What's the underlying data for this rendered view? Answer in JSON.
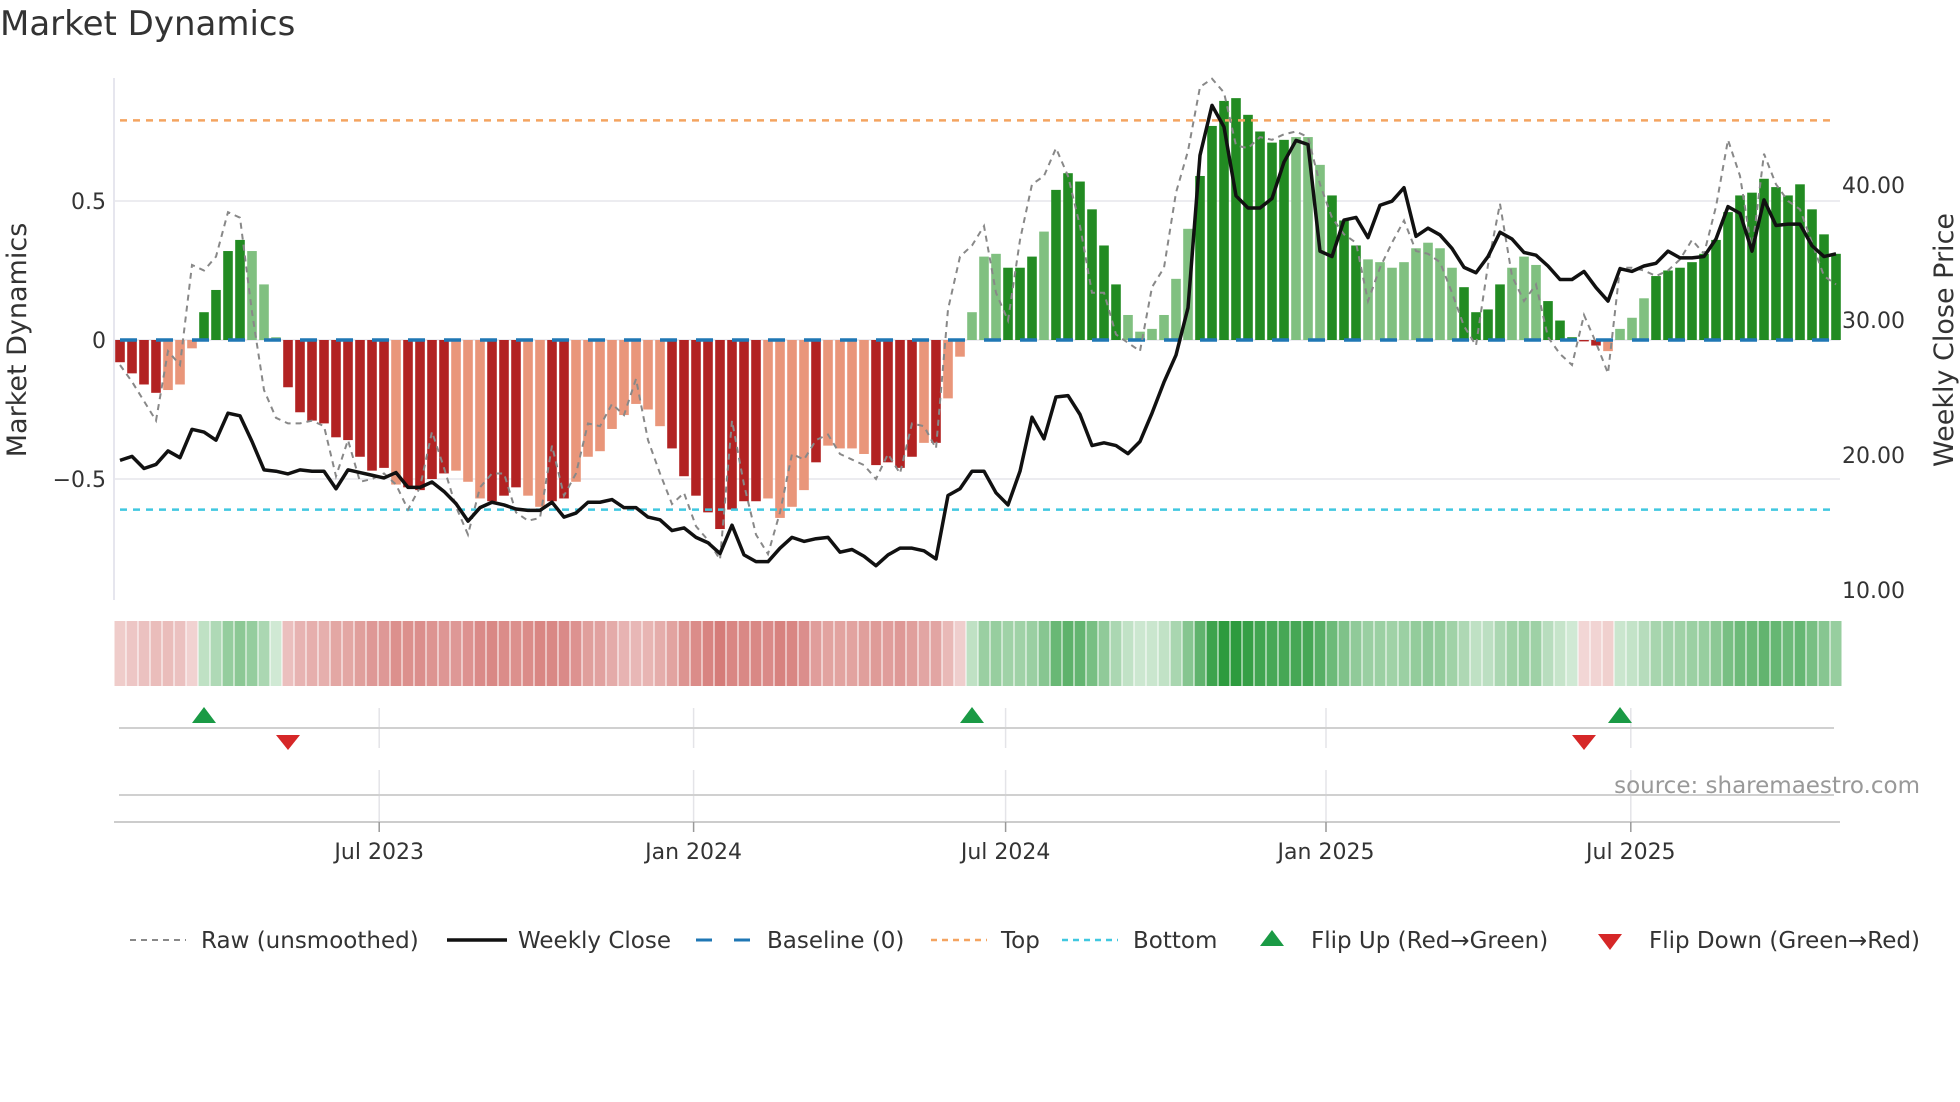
{
  "title": "Market Dynamics",
  "source": "source: sharemaestro.com",
  "colors": {
    "bar_dark_pos": "#228b22",
    "bar_light_pos": "#80c080",
    "bar_dark_neg": "#b22222",
    "bar_light_neg": "#e9967a",
    "close": "#111111",
    "raw": "#888888",
    "baseline": "#1f77b4",
    "top": "#f4a460",
    "bottom": "#40c8e0",
    "flip_up": "#1a9a45",
    "flip_down": "#d62728"
  },
  "chart_data": {
    "type": "bar",
    "title": "Market Dynamics",
    "ylabel": "Market Dynamics",
    "y2label": "Weekly Close Price",
    "ylim": [
      -0.94,
      0.94
    ],
    "y2lim": [
      9.2,
      47.9
    ],
    "yticks": [
      {
        "v": 0.5,
        "label": "0.5"
      },
      {
        "v": 0,
        "label": "0"
      },
      {
        "v": -0.5,
        "label": "−0.5"
      }
    ],
    "y2ticks": [
      {
        "v": 40,
        "label": "40.00"
      },
      {
        "v": 30,
        "label": "30.00"
      },
      {
        "v": 20,
        "label": "20.00"
      },
      {
        "v": 10,
        "label": "10.00"
      }
    ],
    "xticks": [
      {
        "week": 21.6,
        "label": "Jul 2023"
      },
      {
        "week": 47.8,
        "label": "Jan 2024"
      },
      {
        "week": 73.8,
        "label": "Jul 2024"
      },
      {
        "week": 100.5,
        "label": "Jan 2025"
      },
      {
        "week": 125.9,
        "label": "Jul 2025"
      }
    ],
    "top_level": 0.79,
    "bottom_level": -0.61,
    "baseline": 0,
    "momentum": [
      -0.08,
      -0.12,
      -0.16,
      -0.19,
      -0.18,
      -0.16,
      -0.03,
      0.1,
      0.18,
      0.32,
      0.36,
      0.32,
      0.2,
      0.01,
      -0.17,
      -0.26,
      -0.29,
      -0.3,
      -0.35,
      -0.36,
      -0.42,
      -0.47,
      -0.46,
      -0.52,
      -0.53,
      -0.54,
      -0.5,
      -0.48,
      -0.47,
      -0.51,
      -0.57,
      -0.58,
      -0.56,
      -0.53,
      -0.56,
      -0.6,
      -0.58,
      -0.57,
      -0.51,
      -0.42,
      -0.4,
      -0.32,
      -0.27,
      -0.23,
      -0.25,
      -0.31,
      -0.39,
      -0.49,
      -0.56,
      -0.62,
      -0.68,
      -0.61,
      -0.58,
      -0.58,
      -0.57,
      -0.64,
      -0.6,
      -0.54,
      -0.44,
      -0.38,
      -0.39,
      -0.39,
      -0.41,
      -0.45,
      -0.44,
      -0.46,
      -0.42,
      -0.37,
      -0.37,
      -0.21,
      -0.06,
      0.1,
      0.3,
      0.31,
      0.26,
      0.26,
      0.3,
      0.39,
      0.54,
      0.6,
      0.57,
      0.47,
      0.34,
      0.2,
      0.09,
      0.03,
      0.04,
      0.09,
      0.22,
      0.4,
      0.59,
      0.77,
      0.86,
      0.87,
      0.81,
      0.75,
      0.71,
      0.72,
      0.73,
      0.73,
      0.63,
      0.52,
      0.43,
      0.34,
      0.29,
      0.28,
      0.26,
      0.28,
      0.33,
      0.35,
      0.33,
      0.26,
      0.19,
      0.1,
      0.11,
      0.2,
      0.26,
      0.3,
      0.27,
      0.14,
      0.07,
      0.01,
      -0.005,
      -0.02,
      -0.04,
      0.04,
      0.08,
      0.15,
      0.23,
      0.25,
      0.26,
      0.28,
      0.31,
      0.36,
      0.46,
      0.52,
      0.53,
      0.58,
      0.55,
      0.52,
      0.56,
      0.47,
      0.38,
      0.31
    ],
    "shade": "ddddlllddddllldddddddddlddddllldddllddllllllllddddddddlllldllllddddldllllldddlddddddllllllddddddddllldddllllllllddddllldddddllllddddddddddddddddddlldlll",
    "raw": [
      -0.09,
      -0.15,
      -0.22,
      -0.29,
      -0.04,
      -0.09,
      0.27,
      0.25,
      0.3,
      0.46,
      0.44,
      0.1,
      -0.18,
      -0.28,
      -0.3,
      -0.3,
      -0.29,
      -0.31,
      -0.49,
      -0.36,
      -0.51,
      -0.5,
      -0.48,
      -0.52,
      -0.61,
      -0.53,
      -0.33,
      -0.46,
      -0.6,
      -0.7,
      -0.53,
      -0.48,
      -0.48,
      -0.62,
      -0.65,
      -0.64,
      -0.38,
      -0.56,
      -0.48,
      -0.3,
      -0.31,
      -0.23,
      -0.27,
      -0.14,
      -0.36,
      -0.48,
      -0.59,
      -0.55,
      -0.67,
      -0.72,
      -0.79,
      -0.29,
      -0.52,
      -0.7,
      -0.77,
      -0.62,
      -0.41,
      -0.43,
      -0.36,
      -0.34,
      -0.41,
      -0.43,
      -0.45,
      -0.5,
      -0.41,
      -0.48,
      -0.3,
      -0.31,
      -0.39,
      0.11,
      0.3,
      0.34,
      0.41,
      0.17,
      0.07,
      0.36,
      0.56,
      0.59,
      0.69,
      0.59,
      0.41,
      0.17,
      0.17,
      0.02,
      -0.01,
      -0.04,
      0.19,
      0.26,
      0.53,
      0.68,
      0.91,
      0.94,
      0.89,
      0.7,
      0.69,
      0.73,
      0.72,
      0.74,
      0.75,
      0.73,
      0.56,
      0.44,
      0.38,
      0.35,
      0.14,
      0.26,
      0.35,
      0.43,
      0.32,
      0.31,
      0.28,
      0.17,
      0.05,
      -0.02,
      0.27,
      0.49,
      0.23,
      0.14,
      0.2,
      0.01,
      -0.05,
      -0.09,
      0.09,
      -0.01,
      -0.12,
      0.26,
      0.26,
      0.25,
      0.23,
      0.25,
      0.29,
      0.36,
      0.31,
      0.48,
      0.72,
      0.59,
      0.32,
      0.67,
      0.56,
      0.5,
      0.47,
      0.35,
      0.23,
      0.2
    ],
    "close": [
      19.6,
      19.9,
      19.0,
      19.3,
      20.3,
      19.8,
      21.9,
      21.7,
      21.1,
      23.1,
      22.9,
      21.0,
      18.9,
      18.8,
      18.6,
      18.9,
      18.8,
      18.8,
      17.5,
      18.9,
      18.7,
      18.5,
      18.3,
      18.7,
      17.6,
      17.6,
      18.0,
      17.3,
      16.4,
      15.1,
      16.1,
      16.5,
      16.3,
      16.0,
      15.9,
      15.9,
      16.5,
      15.4,
      15.7,
      16.5,
      16.5,
      16.7,
      16.1,
      16.1,
      15.4,
      15.2,
      14.4,
      14.6,
      13.9,
      13.5,
      12.7,
      14.8,
      12.6,
      12.1,
      12.1,
      13.1,
      13.9,
      13.6,
      13.8,
      13.9,
      12.8,
      13.0,
      12.5,
      11.8,
      12.6,
      13.1,
      13.1,
      12.9,
      12.3,
      17.0,
      17.5,
      18.8,
      18.8,
      17.2,
      16.3,
      18.8,
      22.8,
      21.2,
      24.3,
      24.4,
      23.0,
      20.7,
      20.9,
      20.7,
      20.1,
      21.0,
      23.1,
      25.4,
      27.4,
      30.9,
      42.2,
      45.9,
      44.3,
      39.2,
      38.3,
      38.3,
      39.0,
      41.7,
      43.3,
      43.0,
      35.1,
      34.7,
      37.4,
      37.6,
      36.1,
      38.5,
      38.8,
      39.8,
      36.2,
      36.8,
      36.3,
      35.3,
      33.9,
      33.5,
      34.7,
      36.5,
      36.0,
      35.0,
      34.8,
      34.0,
      33.0,
      33.0,
      33.6,
      32.4,
      31.4,
      33.8,
      33.6,
      34.0,
      34.2,
      35.1,
      34.6,
      34.6,
      34.7,
      36.0,
      38.4,
      37.9,
      35.1,
      38.9,
      37.0,
      37.1,
      37.1,
      35.5,
      34.7,
      34.9
    ],
    "flips_up": [
      7,
      71,
      125
    ],
    "flips_down": [
      14,
      122
    ],
    "legend": [
      {
        "key": "raw",
        "label": "Raw (unsmoothed)"
      },
      {
        "key": "close",
        "label": "Weekly Close"
      },
      {
        "key": "baseline",
        "label": "Baseline (0)"
      },
      {
        "key": "top",
        "label": "Top"
      },
      {
        "key": "bottom",
        "label": "Bottom"
      },
      {
        "key": "flip_up",
        "label": "Flip Up (Red→Green)"
      },
      {
        "key": "flip_down",
        "label": "Flip Down (Green→Red)"
      }
    ],
    "legend_position": "bottom"
  }
}
